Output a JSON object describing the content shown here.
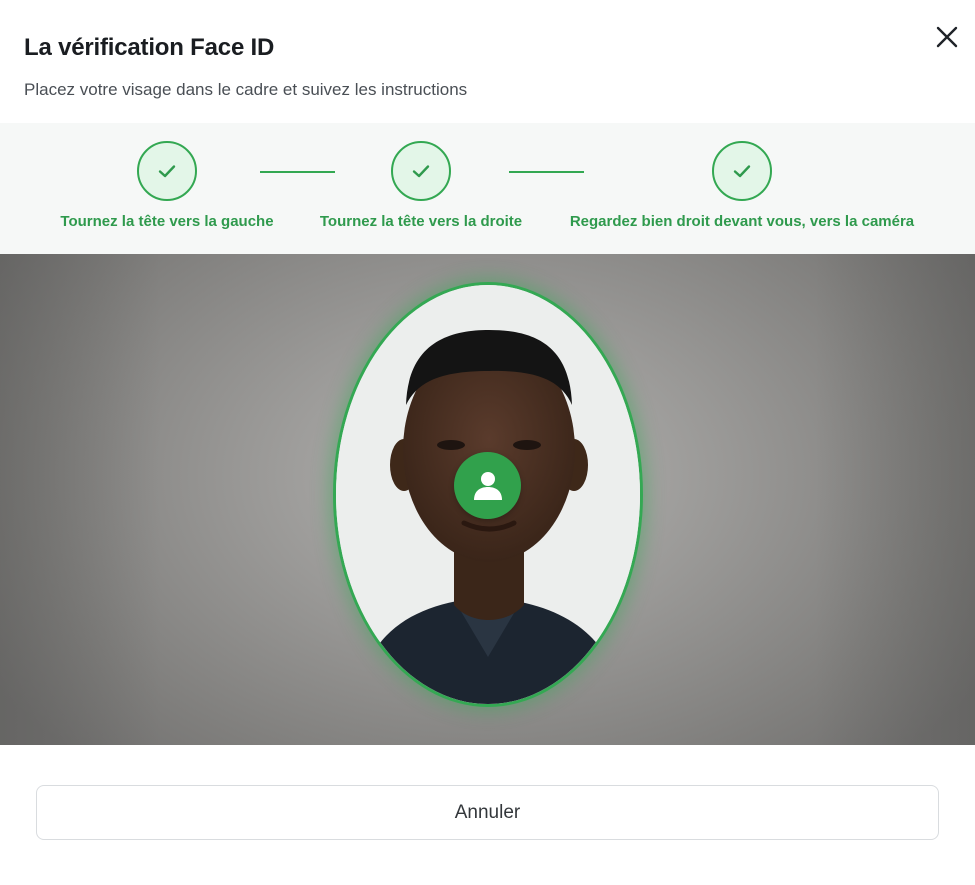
{
  "dialog": {
    "title": "La vérification Face ID",
    "subtitle": "Placez votre visage dans le cadre et suivez les instructions",
    "close_icon": "close-icon"
  },
  "steps": [
    {
      "label": "Tournez la tête vers la gauche",
      "status": "completed",
      "icon": "checkmark-icon"
    },
    {
      "label": "Tournez la tête vers la droite",
      "status": "completed",
      "icon": "checkmark-icon"
    },
    {
      "label": "Regardez bien droit devant vous, vers la caméra",
      "status": "completed",
      "icon": "checkmark-icon"
    }
  ],
  "camera": {
    "overlay_icon": "user-icon"
  },
  "footer": {
    "cancel_label": "Annuler"
  },
  "colors": {
    "accent": "#33a852",
    "accent_light": "#e3f6e8",
    "step_text": "#2f9a4d",
    "steps_bg": "#f6f8f7",
    "border": "#d9dcdf"
  }
}
